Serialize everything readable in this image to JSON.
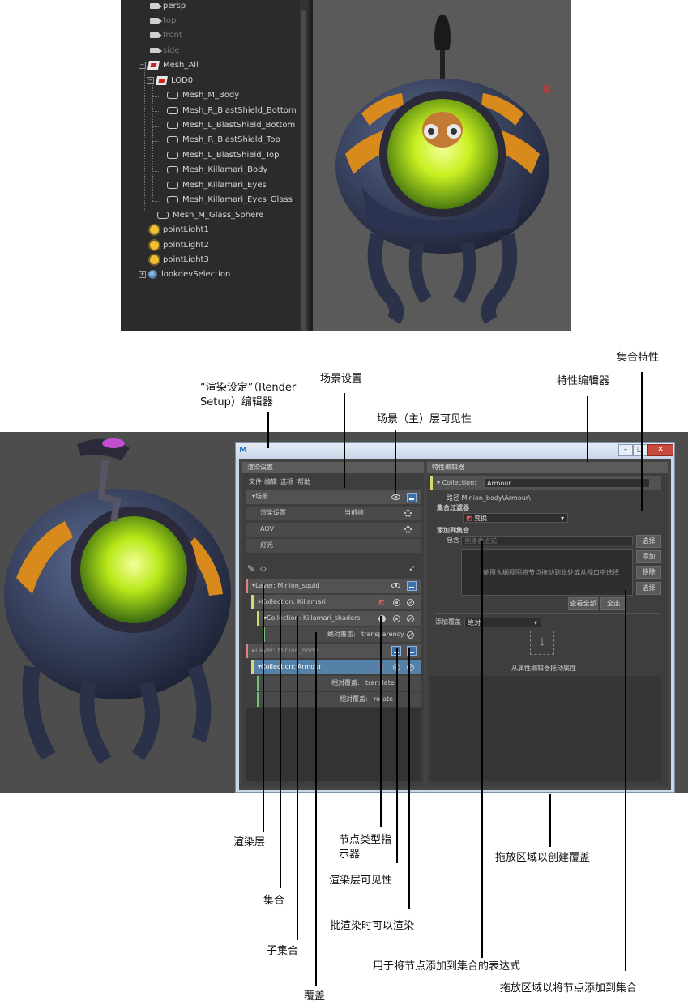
{
  "outliner": {
    "items": [
      {
        "label": "persp",
        "icon": "camera-icon",
        "dim": false
      },
      {
        "label": "top",
        "icon": "camera-icon",
        "dim": true
      },
      {
        "label": "front",
        "icon": "camera-icon",
        "dim": true
      },
      {
        "label": "side",
        "icon": "camera-icon",
        "dim": true
      },
      {
        "label": "Mesh_All",
        "icon": "group-icon",
        "dim": false
      },
      {
        "label": "LOD0",
        "icon": "group-icon",
        "dim": false
      },
      {
        "label": "Mesh_M_Body",
        "icon": "mesh-icon",
        "dim": false
      },
      {
        "label": "Mesh_R_BlastShield_Bottom",
        "icon": "mesh-icon",
        "dim": false
      },
      {
        "label": "Mesh_L_BlastShield_Bottom",
        "icon": "mesh-icon",
        "dim": false
      },
      {
        "label": "Mesh_R_BlastShield_Top",
        "icon": "mesh-icon",
        "dim": false
      },
      {
        "label": "Mesh_L_BlastShield_Top",
        "icon": "mesh-icon",
        "dim": false
      },
      {
        "label": "Mesh_Killamari_Body",
        "icon": "mesh-icon",
        "dim": false
      },
      {
        "label": "Mesh_Killamari_Eyes",
        "icon": "mesh-icon",
        "dim": false
      },
      {
        "label": "Mesh_Killamari_Eyes_Glass",
        "icon": "mesh-icon",
        "dim": false
      },
      {
        "label": "Mesh_M_Glass_Sphere",
        "icon": "mesh-icon",
        "dim": false
      },
      {
        "label": "pointLight1",
        "icon": "point-light-icon",
        "dim": false
      },
      {
        "label": "pointLight2",
        "icon": "point-light-icon",
        "dim": false
      },
      {
        "label": "pointLight3",
        "icon": "point-light-icon",
        "dim": false
      },
      {
        "label": "lookdevSelection",
        "icon": "selection-set-icon",
        "dim": false
      }
    ]
  },
  "render_setup": {
    "tab": "渲染设置",
    "menu": [
      "文件",
      "编辑",
      "选项",
      "帮助"
    ],
    "scene_label": "▾场景",
    "scene_rows": [
      {
        "label": "渲染设置",
        "value": "当前帧"
      },
      {
        "label": "AOV",
        "value": ""
      },
      {
        "label": "灯光",
        "value": ""
      }
    ],
    "layer1": {
      "prefix": "Layer:",
      "name": "Minion_squid"
    },
    "collection1": {
      "prefix": "Collection:",
      "name": "Killamari"
    },
    "subcollection": {
      "prefix": "Collection:",
      "name": "Killamari_shaders"
    },
    "override1": {
      "label": "绝对覆盖:",
      "value": "transparency"
    },
    "layer2": {
      "prefix": "Layer:",
      "name": "Minion_body"
    },
    "collection2": {
      "prefix": "Collection:",
      "name": "Armour"
    },
    "override2": {
      "label": "相对覆盖:",
      "value": "translate"
    },
    "override3": {
      "label": "相对覆盖:",
      "value": "rotate"
    }
  },
  "property_editor": {
    "tab": "特性编辑器",
    "collection_prefix": "Collection:",
    "collection_name": "Armour",
    "path": "路径 Minion_body\\Armour\\",
    "filter_label": "集合过滤器",
    "filter_value": "变换",
    "add_label": "添加到集合",
    "include_label": "包含",
    "include_placeholder": "创建表达式",
    "drop_hint": "使用大纲视图将节点拖动到此处或从视口中选择",
    "buttons": {
      "select": "选择",
      "add": "添加",
      "remove": "移除",
      "select2": "选择",
      "view_all": "查看全部",
      "select_all": "全选"
    },
    "add_override_label": "添加覆盖",
    "add_override_value": "绝对",
    "drag_attr_hint": "从属性编辑器拖动属性"
  },
  "annotations": {
    "editor": "“渲染设定”（Render Setup）编辑器",
    "scene_settings": "场景设置",
    "scene_visibility": "场景（主）层可见性",
    "property_editor": "特性编辑器",
    "collection_properties": "集合特性",
    "render_layer": "渲染层",
    "node_type": "节点类型指示器",
    "collection": "集合",
    "layer_visibility": "渲染层可见性",
    "subcollection": "子集合",
    "batch_render": "批渲染时可以渲染",
    "expression": "用于将节点添加到集合的表达式",
    "override": "覆盖",
    "drop_override": "拖放区域以创建覆盖",
    "drop_nodes": "拖放区域以将节点添加到集合"
  },
  "colors": {
    "accent_blue": "#5580a8",
    "layer_accent": "#e08080",
    "collection_accent": "#d8d870",
    "override_accent": "#70c070"
  }
}
